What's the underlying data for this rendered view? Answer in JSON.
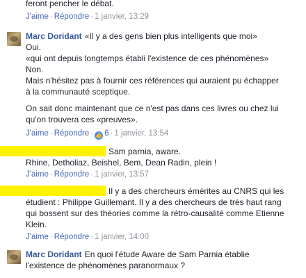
{
  "top_comment": {
    "text": "feront pencher le débat.",
    "like": "J'aime",
    "reply": "Répondre",
    "date": "1 janvier, 13:29"
  },
  "comment1": {
    "author": "Marc Doridant",
    "lines": [
      "«Il y a des gens bien plus intelligents que moi»",
      "Oui.",
      "«qui ont depuis longtemps établi l'existence de ces phénomènes»",
      "Non.",
      "Mais n'hésitez pas à fournir ces références qui auraient pu échapper",
      "à la communauté sceptique.",
      "On sait donc maintenant que ce n'est pas dans ces livres ou chez lui",
      "qu'on trouvera ces «preuves»."
    ],
    "like": "J'aime",
    "reply": "Répondre",
    "reaction_count": "6",
    "date": "1 janvier, 13:54",
    "avatar_icon": "user-avatar-photo"
  },
  "comment2": {
    "line1": "Sam parnia, aware.",
    "line2": "Rhine, Detholiaz, Beishel, Bem, Dean Radin, plein !",
    "like": "J'aime",
    "reply": "Répondre",
    "date": "1 janvier, 13:57"
  },
  "comment3": {
    "line1": "Il y a des chercheurs émérites au CNRS qui les",
    "line2": "étudient : Philippe Guillemant. Il y a des chercheurs de très haut rang",
    "line3": "qui bossent sur des théories comme la rétro-causalité comme Etienne",
    "line4": "Klein.",
    "like": "J'aime",
    "reply": "Répondre",
    "date": "1 janvier, 14:00"
  },
  "comment4": {
    "author": "Marc Doridant",
    "line1": "En quoi l'étude Aware de Sam Parnia établie",
    "line2": "l'existence de phénomènes paranormaux ?",
    "avatar_icon": "user-avatar-photo"
  },
  "colors": {
    "link": "#4267b2",
    "author": "#365899",
    "meta": "#90949c",
    "redaction": "#fff200"
  }
}
